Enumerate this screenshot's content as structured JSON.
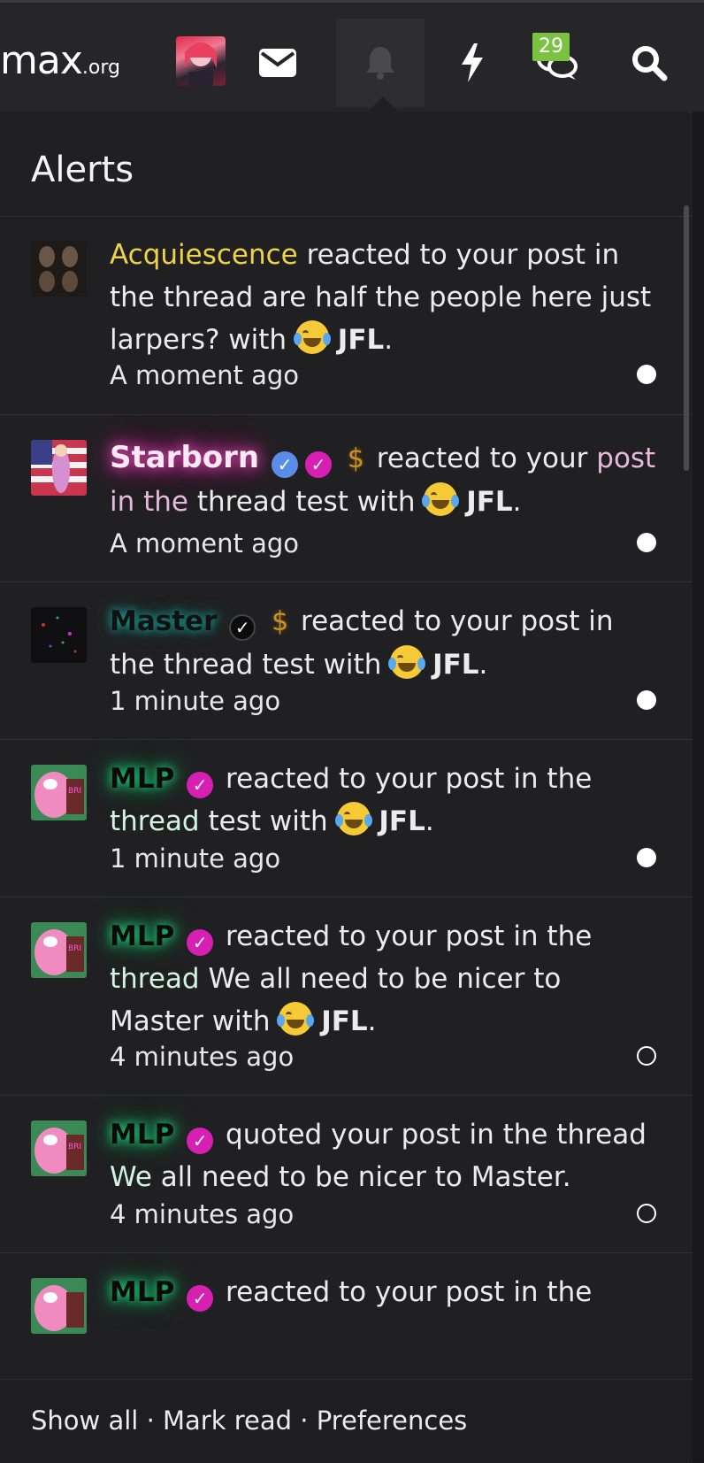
{
  "header": {
    "logo_main": "max",
    "logo_tld": ".org",
    "notification_count": "29",
    "icons": [
      "user-avatar",
      "mail-icon",
      "bell-icon",
      "bolt-icon",
      "chat-icon",
      "search-icon"
    ]
  },
  "panel": {
    "title": "Alerts"
  },
  "alerts": [
    {
      "user": "Acquiescence",
      "text_before": " reacted to your post in the thread are half the people here just larpers? with ",
      "reaction": "JFL",
      "time": "A moment ago",
      "read": false
    },
    {
      "user": "Starborn",
      "text_before": " reacted to your ",
      "highlight": "post in the",
      "text_after": " thread test with ",
      "reaction": "JFL",
      "time": "A moment ago",
      "read": false
    },
    {
      "user": "Master",
      "text_before": " reacted to your post in the thread test with ",
      "reaction": "JFL",
      "time": "1 minute ago",
      "read": false
    },
    {
      "user": "MLP",
      "text_before": " reacted to your post in the ",
      "highlight": "thread",
      "text_after": " test with ",
      "reaction": "JFL",
      "time": "1 minute ago",
      "read": false
    },
    {
      "user": "MLP",
      "text_before": " reacted to your post in the ",
      "highlight": "thread",
      "text_after": " We all need to be nicer to Master with ",
      "reaction": "JFL",
      "time": "4 minutes ago",
      "read": true
    },
    {
      "user": "MLP",
      "text_before": " quoted your post in the thread ",
      "highlight": "We",
      "text_after": " all need to be nicer to Master.",
      "time": "4 minutes ago",
      "read": true
    },
    {
      "user": "MLP",
      "text_before": " reacted to your post in the"
    }
  ],
  "footer": {
    "show_all": "Show all",
    "sep1": " · ",
    "mark_read": "Mark read",
    "sep2": " · ",
    "preferences": "Preferences"
  },
  "colors": {
    "badge": "#7cc242",
    "acquiescence": "#ecd34a",
    "starborn_glow": "#e24fb6",
    "mlp_glow": "#22d07a",
    "verified_blue": "#5b8de8",
    "verified_pink": "#d81fb4"
  }
}
